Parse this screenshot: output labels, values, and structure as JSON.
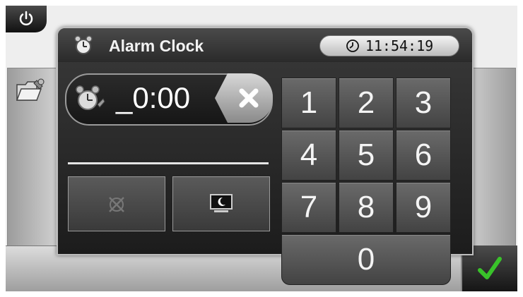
{
  "dialog": {
    "title": "Alarm Clock",
    "current_time": "11:54:19",
    "alarm_time_value": "_0:00"
  },
  "keypad": {
    "keys": [
      "1",
      "2",
      "3",
      "4",
      "5",
      "6",
      "7",
      "8",
      "9",
      "0"
    ]
  },
  "icons": {
    "power": "power-icon",
    "alarm": "alarm-clock-icon",
    "clock": "clock-icon",
    "clear": "clear-x-icon",
    "folder": "folder-settings-icon",
    "disable_alarm": "alarm-off-icon",
    "sleep_mode": "sleep-mode-icon",
    "confirm": "checkmark-icon"
  },
  "colors": {
    "confirm_check": "#39c22a",
    "dialog_bg": "#2a2a2a",
    "key_bg": "#555555"
  }
}
